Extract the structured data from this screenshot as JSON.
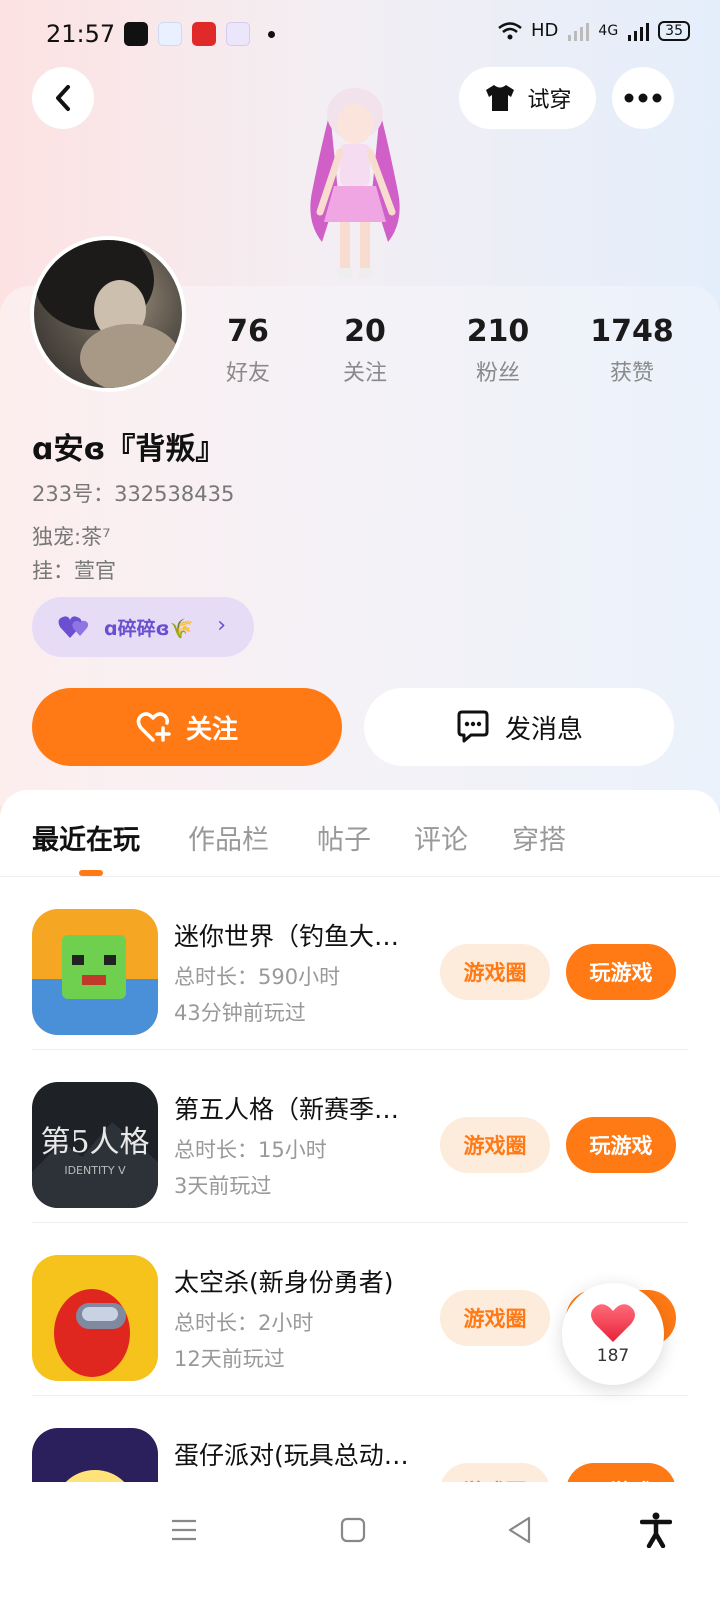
{
  "status_bar": {
    "time": "21:57",
    "network": "HD",
    "cell": "4G",
    "battery": "35"
  },
  "header": {
    "tryon_label": "试穿"
  },
  "profile": {
    "stats": [
      {
        "value": "76",
        "label": "好友"
      },
      {
        "value": "20",
        "label": "关注"
      },
      {
        "value": "210",
        "label": "粉丝"
      },
      {
        "value": "1748",
        "label": "获赞"
      }
    ],
    "username": "ɑ安ɞ『背叛』",
    "uid": "233号：332538435",
    "bio_line1": "独宠:茶⁷",
    "bio_line2": "挂：萱官",
    "couple_name": "ɑ碎碎ɞ🌾",
    "follow_label": "关注",
    "message_label": "发消息"
  },
  "tabs": [
    {
      "label": "最近在玩",
      "active": true
    },
    {
      "label": "作品栏",
      "active": false
    },
    {
      "label": "帖子",
      "active": false
    },
    {
      "label": "评论",
      "active": false
    },
    {
      "label": "穿搭",
      "active": false
    }
  ],
  "games": [
    {
      "title": "迷你世界（钓鱼大…",
      "duration": "总时长：590小时",
      "last_played": "43分钟前玩过",
      "circle_label": "游戏圈",
      "play_label": "玩游戏"
    },
    {
      "title": "第五人格（新赛季…",
      "duration": "总时长：15小时",
      "last_played": "3天前玩过",
      "circle_label": "游戏圈",
      "play_label": "玩游戏"
    },
    {
      "title": "太空杀(新身份勇者)",
      "duration": "总时长：2小时",
      "last_played": "12天前玩过",
      "circle_label": "游戏圈",
      "play_label": "玩游戏"
    },
    {
      "title": "蛋仔派对(玩具总动…",
      "duration": "",
      "last_played": "",
      "circle_label": "游戏圈",
      "play_label": "玩游戏"
    }
  ],
  "like_float": {
    "count": "187"
  },
  "colors": {
    "accent": "#ff7a14",
    "accent_light": "#fdebdc",
    "couple_purple": "#6a4fd1"
  }
}
